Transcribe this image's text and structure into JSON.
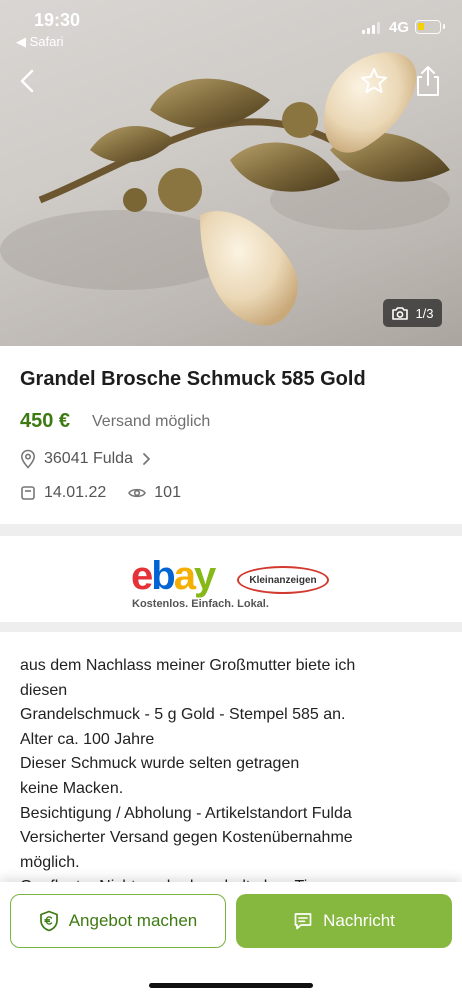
{
  "status": {
    "time": "19:30",
    "back_app": "◀ Safari",
    "network": "4G"
  },
  "gallery": {
    "counter": "1/3"
  },
  "listing": {
    "title": "Grandel Brosche Schmuck 585 Gold",
    "price": "450 €",
    "shipping": "Versand möglich",
    "location": "36041 Fulda",
    "date": "14.01.22",
    "views": "101"
  },
  "banner": {
    "ka_label": "Kleinanzeigen",
    "slogan": "Kostenlos. Einfach. Lokal."
  },
  "description": {
    "lines": [
      "aus dem Nachlass meiner Großmutter biete ich",
      "diesen",
      "Grandelschmuck - 5 g Gold - Stempel 585 an.",
      "Alter ca. 100 Jahre",
      "Dieser Schmuck wurde selten getragen",
      "keine Macken.",
      "Besichtigung / Abholung - Artikelstandort Fulda",
      "Versicherter Versand gegen Kostenübernahme",
      "möglich.",
      "Gepflegter Nichtraucherhaushalt ohne Tiere"
    ]
  },
  "actions": {
    "offer": "Angebot machen",
    "message": "Nachricht"
  },
  "colors": {
    "price_green": "#3e7a12",
    "accent_green": "#86b83f"
  },
  "icons": [
    "back-chevron-icon",
    "star-icon",
    "share-icon",
    "camera-icon",
    "location-pin-icon",
    "chevron-right-icon",
    "calendar-icon",
    "eye-icon",
    "euro-shield-icon",
    "chat-icon"
  ]
}
